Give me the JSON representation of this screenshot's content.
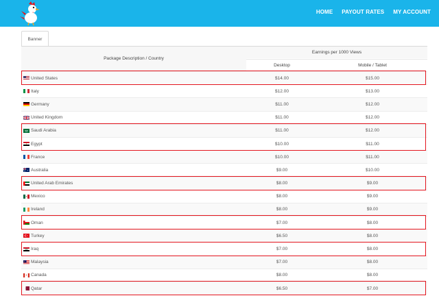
{
  "nav": {
    "home": "HOME",
    "payout_rates": "PAYOUT RATES",
    "my_account": "MY ACCOUNT"
  },
  "tab_label": "Banner",
  "table": {
    "col_country": "Package Description / Country",
    "col_group": "Earnings per 1000 Views",
    "col_desktop": "Desktop",
    "col_mobile": "Mobile / Tablet",
    "rows": [
      {
        "country": "United States",
        "desktop": "$14.00",
        "mobile": "$15.00",
        "flag": "us-flag-icon",
        "highlight": true
      },
      {
        "country": "Italy",
        "desktop": "$12.00",
        "mobile": "$13.00",
        "flag": "italy-flag-icon",
        "highlight": false
      },
      {
        "country": "Germany",
        "desktop": "$11.00",
        "mobile": "$12.00",
        "flag": "germany-flag-icon",
        "highlight": false
      },
      {
        "country": "United Kingdom",
        "desktop": "$11.00",
        "mobile": "$12.00",
        "flag": "uk-flag-icon",
        "highlight": false
      },
      {
        "country": "Saudi Arabia",
        "desktop": "$11.00",
        "mobile": "$12.00",
        "flag": "saudi-flag-icon",
        "highlight": true
      },
      {
        "country": "Egypt",
        "desktop": "$10.00",
        "mobile": "$11.00",
        "flag": "egypt-flag-icon",
        "highlight": true
      },
      {
        "country": "France",
        "desktop": "$10.00",
        "mobile": "$11.00",
        "flag": "france-flag-icon",
        "highlight": false
      },
      {
        "country": "Australia",
        "desktop": "$9.00",
        "mobile": "$10.00",
        "flag": "australia-flag-icon",
        "highlight": false
      },
      {
        "country": "United Arab Emirates",
        "desktop": "$8.00",
        "mobile": "$9.00",
        "flag": "uae-flag-icon",
        "highlight": true
      },
      {
        "country": "Mexico",
        "desktop": "$8.00",
        "mobile": "$9.00",
        "flag": "mexico-flag-icon",
        "highlight": false
      },
      {
        "country": "Ireland",
        "desktop": "$8.00",
        "mobile": "$9.00",
        "flag": "ireland-flag-icon",
        "highlight": false
      },
      {
        "country": "Oman",
        "desktop": "$7.00",
        "mobile": "$8.00",
        "flag": "oman-flag-icon",
        "highlight": true
      },
      {
        "country": "Turkey",
        "desktop": "$6.50",
        "mobile": "$8.00",
        "flag": "turkey-flag-icon",
        "highlight": false
      },
      {
        "country": "Iraq",
        "desktop": "$7.00",
        "mobile": "$8.00",
        "flag": "iraq-flag-icon",
        "highlight": true
      },
      {
        "country": "Malaysia",
        "desktop": "$7.00",
        "mobile": "$8.00",
        "flag": "malaysia-flag-icon",
        "highlight": false
      },
      {
        "country": "Canada",
        "desktop": "$8.00",
        "mobile": "$8.00",
        "flag": "canada-flag-icon",
        "highlight": false
      },
      {
        "country": "Qatar",
        "desktop": "$6.50",
        "mobile": "$7.00",
        "flag": "qatar-flag-icon",
        "highlight": true
      }
    ]
  },
  "colors": {
    "header": "#1ab4ea",
    "highlight": "#e3141d",
    "nav_text": "#ffffff"
  }
}
